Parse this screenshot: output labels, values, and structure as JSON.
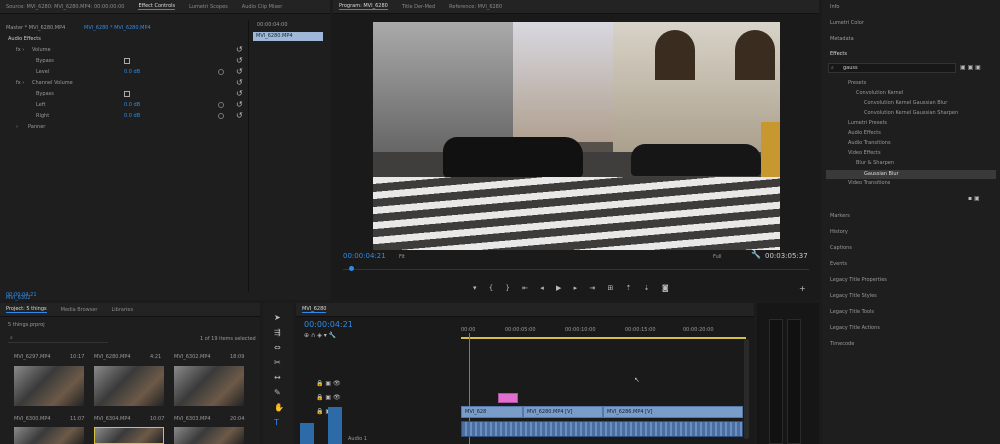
{
  "source_panel": {
    "tabs": [
      "Source: MVI_6280: MVI_6280.MP4: 00:00:00:00",
      "Effect Controls",
      "Lumetri Scopes",
      "Audio Clip Mixer"
    ],
    "active_tab": "Effect Controls",
    "header": "Master * MVI_6280.MP4",
    "clip": "MVI_6280 * MVI_6280.MP4",
    "thumb_time": "00:00:04:00",
    "thumb_clip": "MVI_6280.MP4",
    "section": "Audio Effects",
    "rows": [
      {
        "label": "Volume",
        "value": ""
      },
      {
        "label": "Bypass",
        "value": ""
      },
      {
        "label": "Level",
        "value": "0.0 dB"
      },
      {
        "label": "Channel Volume",
        "value": ""
      },
      {
        "label": "Bypass",
        "value": ""
      },
      {
        "label": "Left",
        "value": "0.0 dB"
      },
      {
        "label": "Right",
        "value": "0.0 dB"
      },
      {
        "label": "Panner",
        "value": ""
      }
    ],
    "bottom_time": "00:00:04:21"
  },
  "program": {
    "tabs": [
      "Program: MVI_6280",
      "Title Der-Med",
      "Reference: MVI_6280"
    ],
    "timecode": "00:00:04:21",
    "fit": "Fit",
    "quality": "Full",
    "duration": "00:03:05:37"
  },
  "right_panel": {
    "top": [
      "Info",
      "Lumetri Color",
      "Metadata"
    ],
    "effects_title": "Effects",
    "search_value": "gauss",
    "tree": [
      "Presets",
      "Convolution Kernel",
      "Convolution Kernel Gaussian Blur",
      "Convolution Kernel Gaussian Sharpen",
      "Lumetri Presets",
      "Audio Effects",
      "Audio Transitions",
      "Video Effects",
      "Blur & Sharpen",
      "Gaussian Blur",
      "Video Transitions"
    ],
    "lower": [
      "Markers",
      "History",
      "Captions",
      "Events",
      "Legacy Title Properties",
      "Legacy Title Styles",
      "Legacy Title Tools",
      "Legacy Title Actions",
      "Timecode"
    ]
  },
  "project": {
    "tabs": [
      "Project: 5 things",
      "Media Browser",
      "Libraries"
    ],
    "name": "5 things.prproj",
    "items_info": "1 of 19 items selected",
    "items": [
      {
        "name": "MVI_6297.MP4",
        "dur": "10:17"
      },
      {
        "name": "MVI_6280.MP4",
        "dur": "4:21"
      },
      {
        "name": "MVI_6302.MP4",
        "dur": "18:09"
      },
      {
        "name": "MVI_6300.MP4",
        "dur": "11:07"
      },
      {
        "name": "MVI_6304.MP4",
        "dur": "10:07"
      },
      {
        "name": "MVI_6303.MP4",
        "dur": "20:04"
      }
    ],
    "label": "MVI_6302"
  },
  "timeline": {
    "tab": "MVI_6280",
    "timecode": "00:00:04:21",
    "ruler": [
      "00:00",
      "00:00:05:00",
      "00:00:10:00",
      "00:00:15:00",
      "00:00:20:00"
    ],
    "clip_labels": [
      "MVI_628",
      "MVI_6280.MP4 [V]",
      "MVI_6286.MP4 [V]"
    ],
    "track": "Audio 1"
  },
  "colors": {
    "accent": "#2d8ceb",
    "playhead": "#2d8ceb",
    "video_clip": "#7a9cc8",
    "audio_clip": "#4a6fa0",
    "pink_clip": "#e070d0",
    "yellow": "#d8c040"
  }
}
